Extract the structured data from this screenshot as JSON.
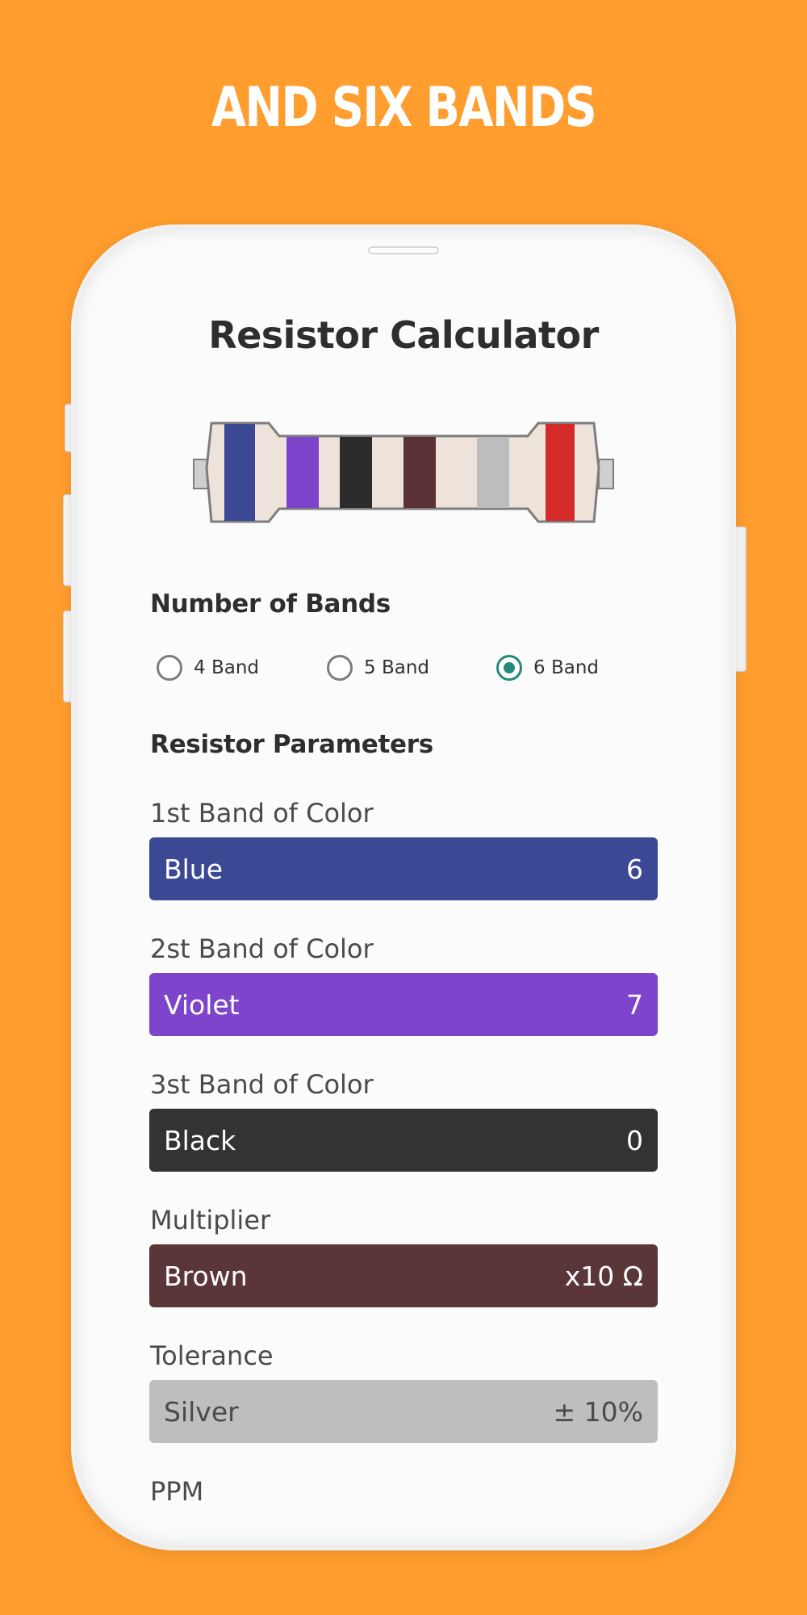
{
  "headline": "AND SIX BANDS",
  "app": {
    "title": "Resistor Calculator"
  },
  "resistor": {
    "band_colors": [
      "#3B4994",
      "#7E44CC",
      "#2C2C2C",
      "#5A3236",
      "#BDBDBD",
      "#D52A2A"
    ]
  },
  "bands_section": {
    "title": "Number of Bands",
    "options": [
      {
        "label": "4 Band",
        "checked": false
      },
      {
        "label": "5 Band",
        "checked": false
      },
      {
        "label": "6 Band",
        "checked": true
      }
    ]
  },
  "params_section": {
    "title": "Resistor Parameters",
    "fields": [
      {
        "label": "1st Band of Color",
        "color_name": "Blue",
        "value": "6",
        "color": "#3B4994"
      },
      {
        "label": "2st Band of Color",
        "color_name": "Violet",
        "value": "7",
        "color": "#7E44CC"
      },
      {
        "label": "3st Band of Color",
        "color_name": "Black",
        "value": "0",
        "color": "#333333"
      },
      {
        "label": "Multiplier",
        "color_name": "Brown",
        "value": "x10 Ω",
        "color": "#5B3638"
      },
      {
        "label": "Tolerance",
        "color_name": "Silver",
        "value": "± 10%",
        "color": "#BEBDBF"
      }
    ],
    "ppm_label": "PPM"
  },
  "colors": {
    "background": "#FF9D2E",
    "radio_accent": "#26897D"
  }
}
